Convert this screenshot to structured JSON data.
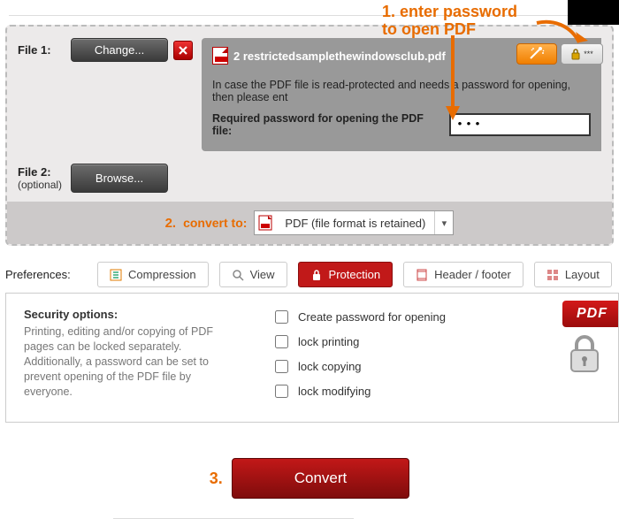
{
  "annotation": {
    "line1": "1. enter password",
    "line2": "to open PDF"
  },
  "file1": {
    "label": "File 1:",
    "change_btn": "Change...",
    "filename": "2 restrictedsamplethewindowsclub.pdf",
    "info_text": "In case the PDF file is read-protected and needs a password for opening, then please ent",
    "pw_label": "Required password for opening the PDF file:",
    "pw_value": "•••",
    "lock_stars": "***"
  },
  "file2": {
    "label": "File 2:",
    "optional": "(optional)",
    "browse_btn": "Browse..."
  },
  "convert_to": {
    "step": "2.",
    "label": "convert to:",
    "selected": "PDF (file format is retained)"
  },
  "prefs": {
    "label": "Preferences:",
    "tabs": {
      "compression": "Compression",
      "view": "View",
      "protection": "Protection",
      "header": "Header / footer",
      "layout": "Layout"
    }
  },
  "security": {
    "title": "Security options:",
    "desc": "Printing, editing and/or copying of PDF pages can be locked separately. Additionally, a password can be set to prevent opening of the PDF file by everyone.",
    "checks": {
      "create_pw": "Create password for opening",
      "lock_printing": "lock printing",
      "lock_copying": "lock copying",
      "lock_modifying": "lock modifying"
    },
    "badge": "PDF"
  },
  "convert": {
    "step": "3.",
    "btn": "Convert"
  }
}
